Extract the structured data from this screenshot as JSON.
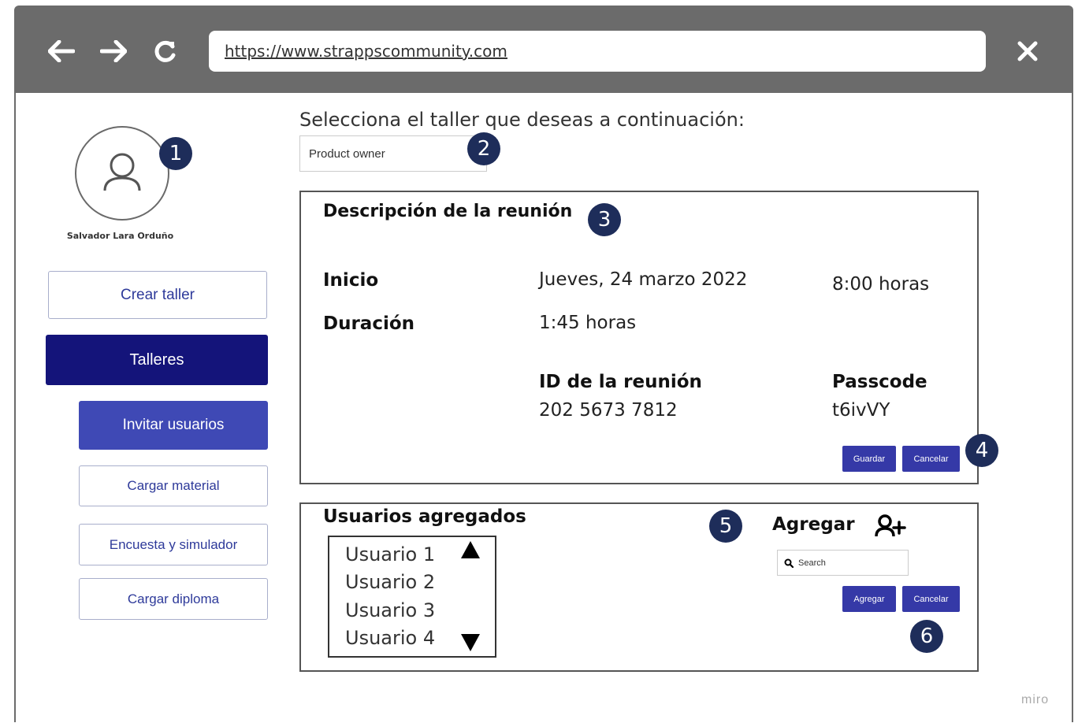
{
  "browser": {
    "back_icon": "arrow-left-icon",
    "forward_icon": "arrow-right-icon",
    "reload_icon": "reload-icon",
    "close_icon": "close-icon",
    "url": "https://www.strappscommunity.com"
  },
  "profile": {
    "name": "Salvador Lara Orduño"
  },
  "sidebar": {
    "items": [
      {
        "label": "Crear taller"
      },
      {
        "label": "Talleres"
      },
      {
        "label": "Invitar usuarios"
      },
      {
        "label": "Cargar material"
      },
      {
        "label": "Encuesta y simulador"
      },
      {
        "label": "Cargar diploma"
      }
    ]
  },
  "workshop_select": {
    "prompt": "Selecciona el taller que deseas a continuación:",
    "value": "Product owner"
  },
  "meeting": {
    "title": "Descripción de la reunión",
    "inicio_label": "Inicio",
    "inicio_date": "Jueves, 24 marzo 2022",
    "inicio_time": "8:00 horas",
    "duracion_label": "Duración",
    "duracion_value": "1:45 horas",
    "id_label": "ID de la reunión",
    "id_value": "202 5673 7812",
    "passcode_label": "Passcode",
    "passcode_value": "t6ivVY",
    "save_label": "Guardar",
    "cancel_label": "Cancelar"
  },
  "users": {
    "title": "Usuarios agregados",
    "list": [
      "Usuario 1",
      "Usuario 2",
      "Usuario 3",
      "Usuario 4"
    ],
    "add_title": "Agregar",
    "search_placeholder": "Search",
    "add_label": "Agregar",
    "cancel_label": "Cancelar"
  },
  "badges": [
    "1",
    "2",
    "3",
    "4",
    "5",
    "6"
  ],
  "watermark": "miro",
  "colors": {
    "frame": "#6b6b6b",
    "primary_dark": "#14147a",
    "primary": "#3f49b5",
    "badge": "#1e2d5a"
  }
}
